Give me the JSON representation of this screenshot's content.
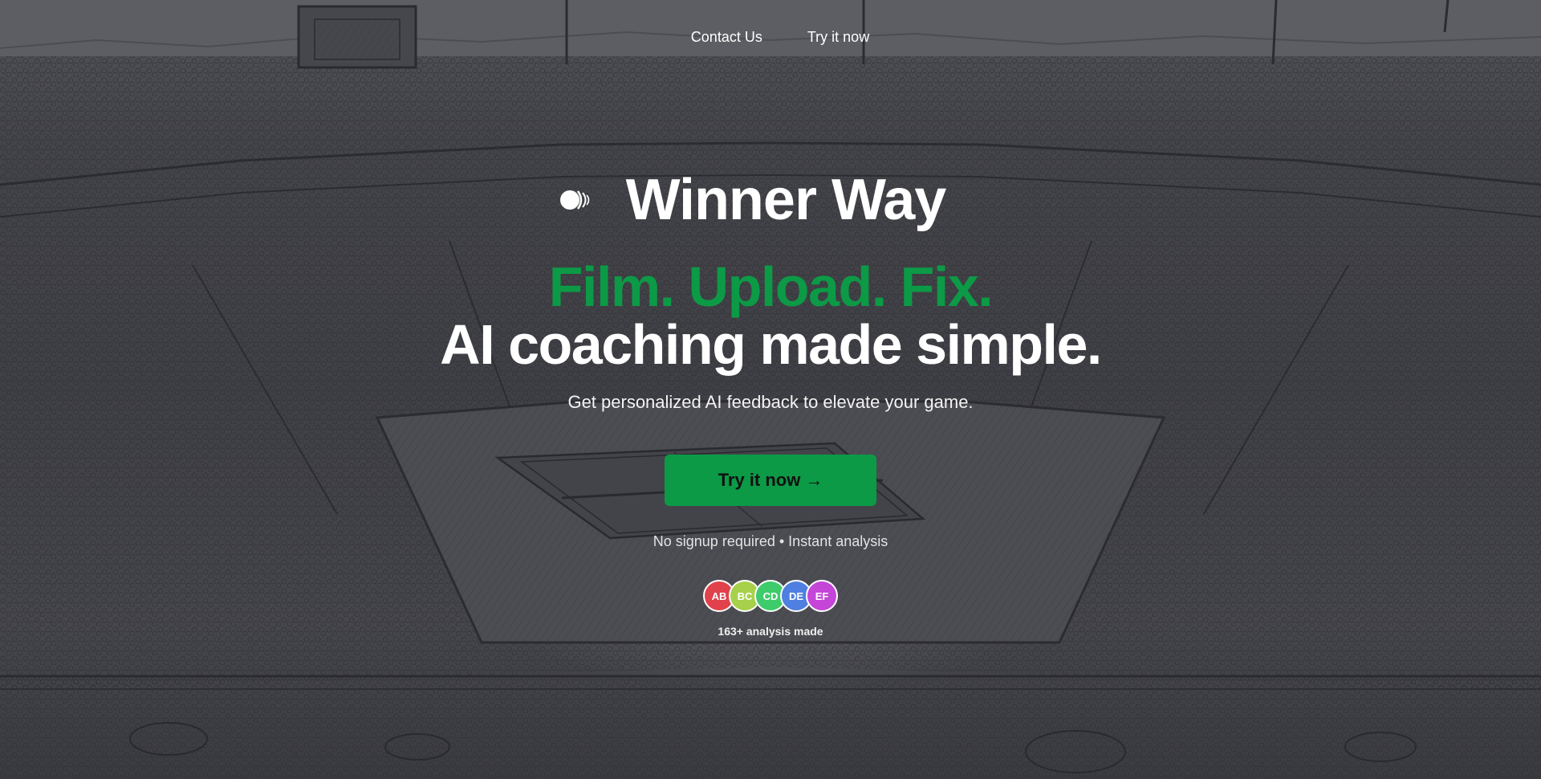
{
  "nav": {
    "contact_label": "Contact Us",
    "try_label": "Try it now"
  },
  "brand": {
    "name": "Winner Way",
    "logo_icon": "tennis-ball-icon"
  },
  "hero": {
    "tagline_green": "Film. Upload. Fix.",
    "tagline_white": "AI coaching made simple.",
    "subtitle": "Get personalized AI feedback to elevate your game.",
    "cta_label": "Try it now",
    "cta_arrow": "→",
    "note": "No signup required • Instant analysis"
  },
  "social_proof": {
    "avatars": [
      {
        "initials": "AB",
        "color": "#e0414b"
      },
      {
        "initials": "BC",
        "color": "#a6d14a"
      },
      {
        "initials": "CD",
        "color": "#3ecb6b"
      },
      {
        "initials": "DE",
        "color": "#4f7fe0"
      },
      {
        "initials": "EF",
        "color": "#c545d8"
      }
    ],
    "count_text": "163+ analysis made"
  },
  "colors": {
    "accent_green": "#0c9a46",
    "text_white": "#ffffff"
  }
}
